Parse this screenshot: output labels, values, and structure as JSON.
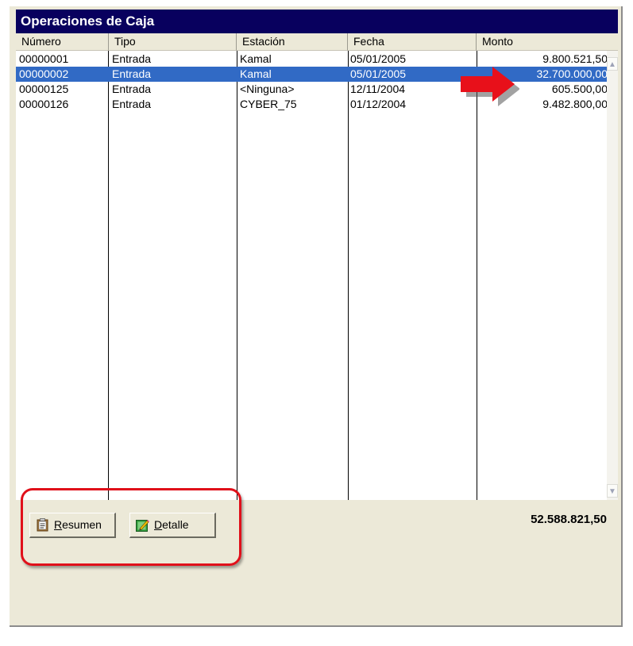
{
  "window": {
    "title": "Operaciones de Caja"
  },
  "table": {
    "columns": [
      "Número",
      "Tipo",
      "Estación",
      "Fecha",
      "Monto"
    ],
    "rows": [
      [
        "00000001",
        "Entrada",
        "Kamal",
        "05/01/2005",
        "9.800.521,50"
      ],
      [
        "00000002",
        "Entrada",
        "Kamal",
        "05/01/2005",
        "32.700.000,00"
      ],
      [
        "00000125",
        "Entrada",
        "<Ninguna>",
        "12/11/2004",
        "605.500,00"
      ],
      [
        "00000126",
        "Entrada",
        "CYBER_75",
        "01/12/2004",
        "9.482.800,00"
      ]
    ],
    "selected_row": 2
  },
  "scrollbar": {
    "up_icon": "chevron-up-icon",
    "down_icon": "chevron-down-icon"
  },
  "annotation": {
    "arrow_color": "#e8101a",
    "frame_color": "#e0101a"
  },
  "footer": {
    "total": "52.588.821,50",
    "buttons": [
      {
        "label": "Resumen",
        "icon": "clipboard-icon"
      },
      {
        "label": "Detalle",
        "icon": "edit-pencil-icon"
      }
    ]
  }
}
